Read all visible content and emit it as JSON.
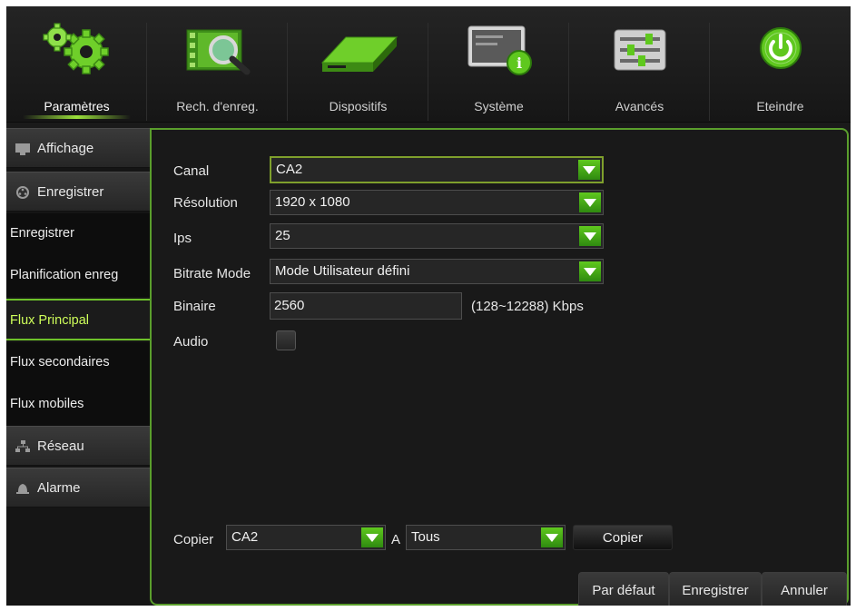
{
  "topnav": {
    "items": [
      {
        "label": "Paramètres",
        "icon": "gears-icon"
      },
      {
        "label": "Rech. d'enreg.",
        "icon": "film-search-icon"
      },
      {
        "label": "Dispositifs",
        "icon": "hard-drive-icon"
      },
      {
        "label": "Système",
        "icon": "monitor-info-icon"
      },
      {
        "label": "Avancés",
        "icon": "sliders-icon"
      },
      {
        "label": "Eteindre",
        "icon": "power-icon"
      }
    ],
    "active_index": 0,
    "accent": "#8fd43a"
  },
  "sidebar": {
    "categories": {
      "affichage": "Affichage",
      "enregistrer": "Enregistrer",
      "reseau": "Réseau",
      "alarme": "Alarme"
    },
    "sub_items": [
      "Enregistrer",
      "Planification enreg",
      "Flux Principal",
      "Flux secondaires",
      "Flux mobiles"
    ],
    "active_sub": "Flux Principal"
  },
  "form": {
    "canal": {
      "label": "Canal",
      "value": "CA2"
    },
    "resolution": {
      "label": "Résolution",
      "value": "1920 x 1080"
    },
    "ips": {
      "label": "Ips",
      "value": "25"
    },
    "bitrate_mode": {
      "label": "Bitrate Mode",
      "value": "Mode Utilisateur défini"
    },
    "binaire": {
      "label": "Binaire",
      "value": "2560",
      "range": "(128~12288) Kbps"
    },
    "audio": {
      "label": "Audio",
      "checked": false
    }
  },
  "copy": {
    "label": "Copier",
    "from_value": "CA2",
    "to_label": "A",
    "to_value": "Tous",
    "button": "Copier"
  },
  "footer": {
    "default_button": "Par défaut",
    "save_button": "Enregistrer",
    "cancel_button": "Annuler"
  },
  "colors": {
    "accent_green": "#5fc81e",
    "panel_border": "#5a9e2c",
    "active_text": "#cfff5a"
  }
}
